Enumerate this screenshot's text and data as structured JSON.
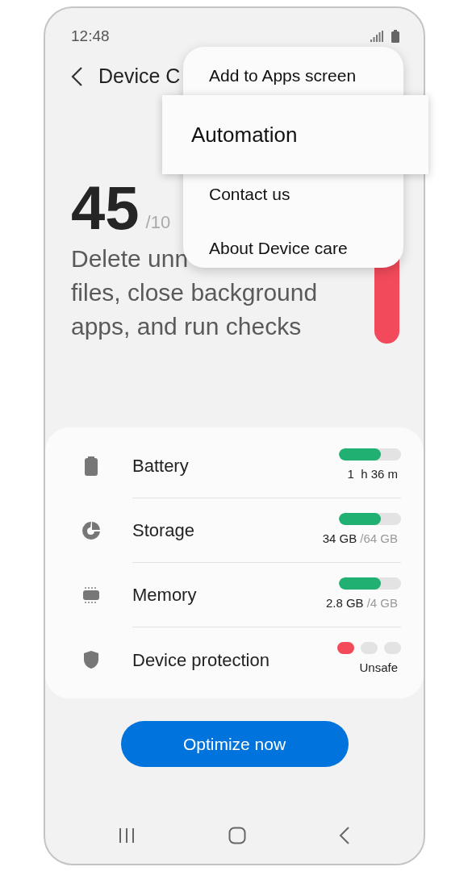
{
  "status_bar": {
    "time": "12:48"
  },
  "header": {
    "title": "Device C"
  },
  "score": {
    "value": "45",
    "max": "/10"
  },
  "description": [
    "Delete unn",
    "files, close background",
    "apps, and run checks"
  ],
  "menu": [
    {
      "label": "Add to Apps screen",
      "selected": false
    },
    {
      "label": "Automation",
      "selected": true
    },
    {
      "label": "Contact us",
      "selected": false
    },
    {
      "label": "About Device care",
      "selected": false
    }
  ],
  "items": [
    {
      "kind": "bar",
      "label": "Battery",
      "level": 0.67,
      "value": "1  h 36 m"
    },
    {
      "kind": "bar",
      "label": "Storage",
      "level": 0.67,
      "value": "34 GB",
      "total": "/64 GB"
    },
    {
      "kind": "bar",
      "label": "Memory",
      "level": 0.67,
      "value": "2.8 GB",
      "total": "/4 GB"
    },
    {
      "kind": "dots",
      "label": "Device protection",
      "value": "Unsafe",
      "dots": [
        {
          "color": "#f24a5a"
        },
        {
          "color": "#e3e3e3"
        },
        {
          "color": "#e3e3e3"
        }
      ]
    }
  ],
  "button": {
    "label": "Optimize now"
  }
}
